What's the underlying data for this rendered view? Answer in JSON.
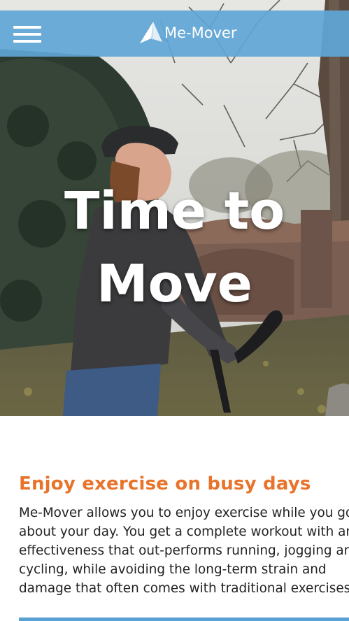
{
  "header": {
    "menu_icon": "hamburger-menu-icon",
    "logo_icon": "paper-plane-icon",
    "logo_text": "Me-Mover",
    "background_color": "#60a6d7"
  },
  "hero": {
    "title_line1": "Time to",
    "title_line2": "Move"
  },
  "content": {
    "heading": "Enjoy exercise on busy days",
    "heading_color": "#e8742c",
    "paragraph_lines": [
      "Me-Mover allows you to enjoy exercise while you go",
      "about your day. You get a complete workout with an",
      "effectiveness that out-performs running, jogging and",
      "cycling, while avoiding the long-term strain and",
      "damage that often comes with traditional exercises."
    ]
  }
}
